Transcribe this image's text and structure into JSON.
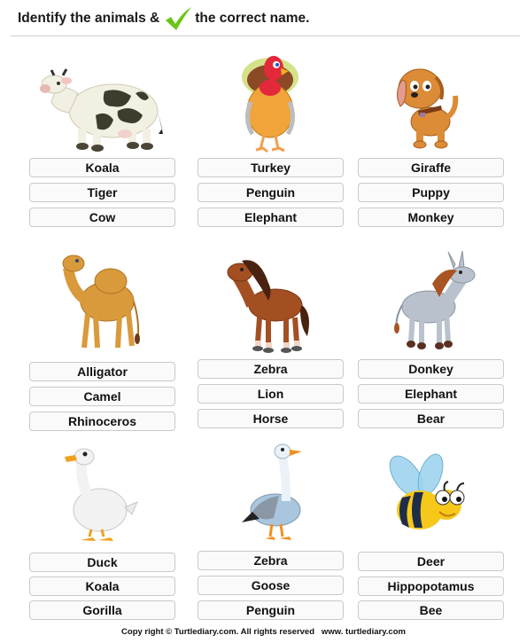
{
  "header": {
    "title_before": "Identify the animals &",
    "title_after": "the correct name.",
    "check_icon_color": "#6cc417"
  },
  "cells": [
    {
      "animal": "cow",
      "options": [
        "Koala",
        "Tiger",
        "Cow"
      ]
    },
    {
      "animal": "turkey",
      "options": [
        "Turkey",
        "Penguin",
        "Elephant"
      ]
    },
    {
      "animal": "puppy",
      "options": [
        "Giraffe",
        "Puppy",
        "Monkey"
      ]
    },
    {
      "animal": "camel",
      "options": [
        "Alligator",
        "Camel",
        "Rhinoceros"
      ]
    },
    {
      "animal": "horse",
      "options": [
        "Zebra",
        "Lion",
        "Horse"
      ]
    },
    {
      "animal": "donkey",
      "options": [
        "Donkey",
        "Elephant",
        "Bear"
      ]
    },
    {
      "animal": "duck",
      "options": [
        "Duck",
        "Koala",
        "Gorilla"
      ]
    },
    {
      "animal": "goose",
      "options": [
        "Zebra",
        "Goose",
        "Penguin"
      ]
    },
    {
      "animal": "bee",
      "options": [
        "Deer",
        "Hippopotamus",
        "Bee"
      ]
    }
  ],
  "footer": {
    "text": "Copy right © Turtlediary.com. All rights reserved   www. turtlediary.com"
  }
}
